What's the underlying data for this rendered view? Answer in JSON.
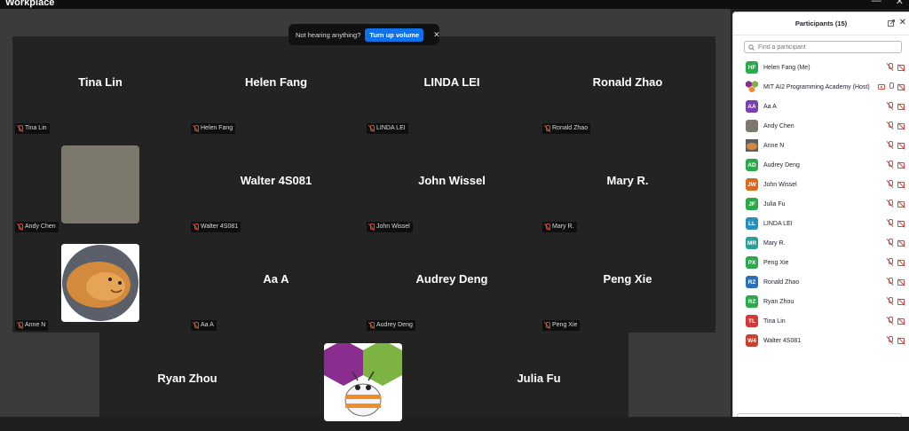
{
  "app": {
    "title": "Workplace",
    "minimize_glyph": "—",
    "close_glyph": "✕"
  },
  "toast": {
    "message": "Not hearing anything?",
    "button_label": "Turn up volume",
    "close_glyph": "✕"
  },
  "tiles": [
    {
      "name": "Tina Lin",
      "label": "Tina Lin"
    },
    {
      "name": "Helen Fang",
      "label": "Helen Fang"
    },
    {
      "name": "LINDA LEI",
      "label": "LINDA LEI"
    },
    {
      "name": "Ronald Zhao",
      "label": "Ronald Zhao"
    },
    {
      "name": "",
      "label": "Andy Chen"
    },
    {
      "name": "Walter 4S081",
      "label": "Walter 4S081"
    },
    {
      "name": "John Wissel",
      "label": "John Wissel"
    },
    {
      "name": "Mary R.",
      "label": "Mary R."
    },
    {
      "name": "",
      "label": "Anne N"
    },
    {
      "name": "Aa A",
      "label": "Aa A"
    },
    {
      "name": "Audrey Deng",
      "label": "Audrey Deng"
    },
    {
      "name": "Peng Xie",
      "label": "Peng Xie"
    },
    {
      "name": "Ryan Zhou",
      "label": ""
    },
    {
      "name": "",
      "label": ""
    },
    {
      "name": "Julia Fu",
      "label": ""
    }
  ],
  "panel": {
    "title": "Participants (15)",
    "search_placeholder": "Find a participant",
    "close_glyph": "✕",
    "participants": [
      {
        "initials": "HF",
        "name": "Helen Fang (Me)",
        "color": "#2ea84f"
      },
      {
        "initials": "",
        "name": "MIT AI2 Programming Academy (Host)",
        "color": "#8b2c8f"
      },
      {
        "initials": "AA",
        "name": "Aa A",
        "color": "#7a3fb0"
      },
      {
        "initials": "",
        "name": "Andy Chen",
        "color": "#7c786c"
      },
      {
        "initials": "",
        "name": "Anne N",
        "color": "#c7883b"
      },
      {
        "initials": "AD",
        "name": "Audrey Deng",
        "color": "#2ea84f"
      },
      {
        "initials": "JW",
        "name": "John Wissel",
        "color": "#d9691e"
      },
      {
        "initials": "JF",
        "name": "Julia Fu",
        "color": "#2ea84f"
      },
      {
        "initials": "LL",
        "name": "LINDA LEI",
        "color": "#2a8fb8"
      },
      {
        "initials": "MR",
        "name": "Mary R.",
        "color": "#2aa198"
      },
      {
        "initials": "PX",
        "name": "Peng Xie",
        "color": "#2ea84f"
      },
      {
        "initials": "RZ",
        "name": "Ronald Zhao",
        "color": "#2a6fb8"
      },
      {
        "initials": "RZ",
        "name": "Ryan Zhou",
        "color": "#2ea84f"
      },
      {
        "initials": "TL",
        "name": "Tina Lin",
        "color": "#d03a3a"
      },
      {
        "initials": "W4",
        "name": "Walter 4S081",
        "color": "#c8412e"
      }
    ]
  }
}
